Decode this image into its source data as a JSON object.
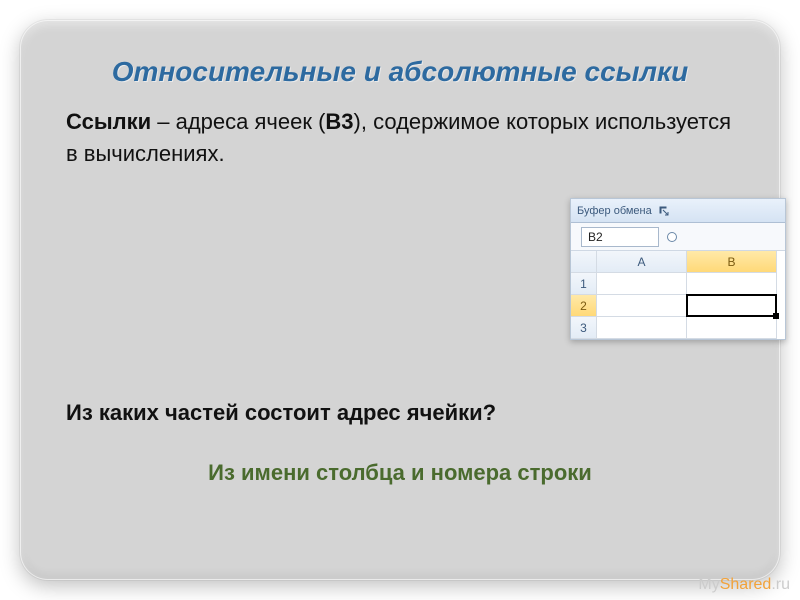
{
  "title": "Относительные и абсолютные ссылки",
  "body": {
    "lead_bold": "Ссылки",
    "p1": " – адреса ячеек (",
    "cell": "В3",
    "p2": "), содержимое которых используется в вычислениях."
  },
  "question": "Из каких частей состоит адрес ячейки?",
  "answer": "Из имени столбца и номера строки",
  "excel": {
    "ribbon_label": "Буфер обмена",
    "name_box": "B2",
    "cols": [
      "A",
      "B"
    ],
    "rows": [
      "1",
      "2",
      "3"
    ],
    "selected": {
      "row": "2",
      "col": "B"
    }
  },
  "watermark": {
    "left": "My",
    "right": "Shared",
    "suffix": ".ru"
  }
}
